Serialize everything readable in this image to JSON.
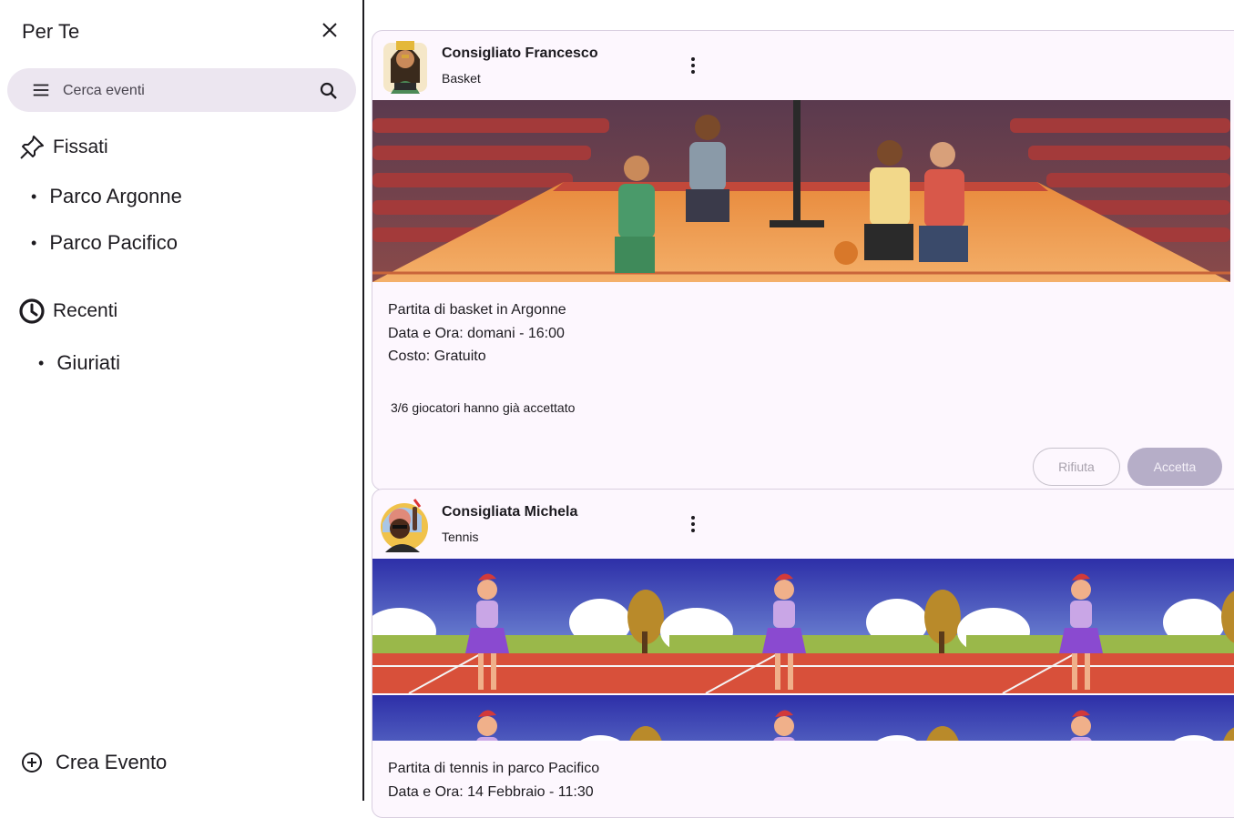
{
  "sidebar": {
    "title": "Per Te",
    "search_placeholder": "Cerca eventi",
    "pinned": {
      "label": "Fissati",
      "items": [
        "Parco Argonne",
        "Parco Pacifico"
      ]
    },
    "recent": {
      "label": "Recenti",
      "items": [
        "Giuriati"
      ]
    },
    "create_label": "Crea Evento"
  },
  "cards": [
    {
      "title": "Consigliato Francesco",
      "subtitle": "Basket",
      "description": [
        "Partita di basket in Argonne",
        "Data e Ora: domani - 16:00",
        "Costo: Gratuito"
      ],
      "players": "3/6 giocatori hanno già accettato",
      "reject_label": "Rifiuta",
      "accept_label": "Accetta"
    },
    {
      "title": "Consigliata Michela",
      "subtitle": "Tennis",
      "description": [
        "Partita di tennis in parco Pacifico",
        "Data e Ora: 14 Febbraio - 11:30"
      ]
    }
  ],
  "colors": {
    "card_bg": "#fdf7fe",
    "search_bg": "#ece6f0",
    "accept_bg": "#b6aec8"
  },
  "icons": [
    "close-icon",
    "menu-icon",
    "search-icon",
    "pin-icon",
    "clock-icon",
    "add-circle-icon",
    "more-vert-icon"
  ]
}
